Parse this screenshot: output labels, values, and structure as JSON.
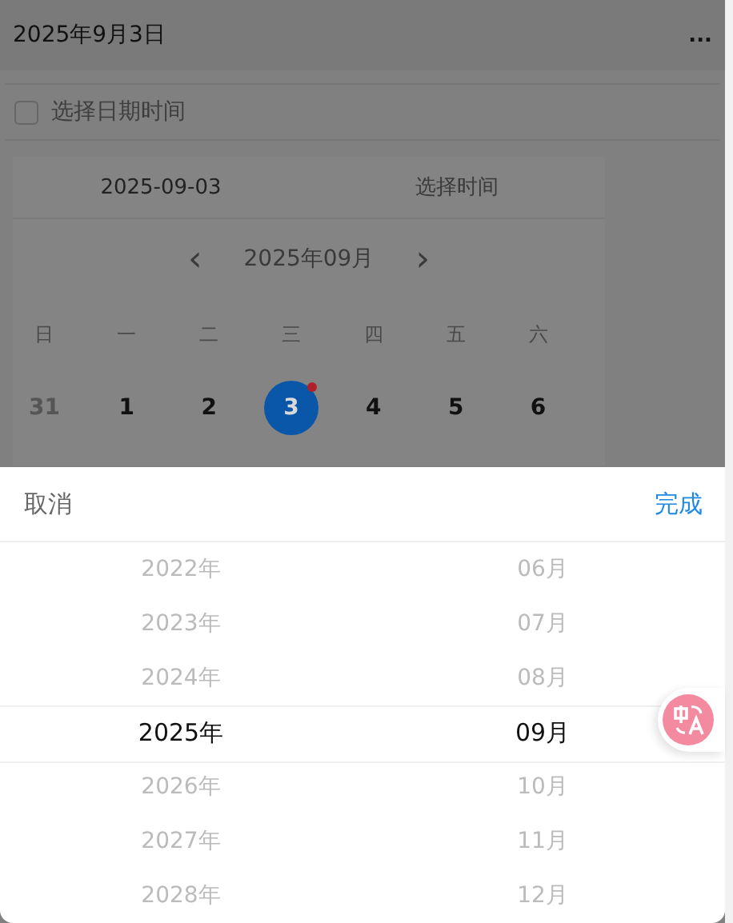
{
  "header": {
    "title": "2025年9月3日",
    "menu": "..."
  },
  "field": {
    "label": "选择日期时间",
    "checked": false
  },
  "calendar": {
    "tabs": [
      {
        "label": "2025-09-03",
        "selected": true
      },
      {
        "label": "选择时间",
        "selected": false
      }
    ],
    "prev": "‹",
    "month": "2025年09月",
    "next": "›",
    "weekdays": [
      "日",
      "一",
      "二",
      "三",
      "四",
      "五",
      "六"
    ],
    "days": [
      {
        "label": "31",
        "other_month": true,
        "selected": false,
        "marked": false
      },
      {
        "label": "1",
        "other_month": false,
        "selected": false,
        "marked": false
      },
      {
        "label": "2",
        "other_month": false,
        "selected": false,
        "marked": false
      },
      {
        "label": "3",
        "other_month": false,
        "selected": true,
        "marked": true
      },
      {
        "label": "4",
        "other_month": false,
        "selected": false,
        "marked": false
      },
      {
        "label": "5",
        "other_month": false,
        "selected": false,
        "marked": false
      },
      {
        "label": "6",
        "other_month": false,
        "selected": false,
        "marked": false
      }
    ]
  },
  "sheet": {
    "cancel": "取消",
    "done": "完成",
    "columns": [
      {
        "items": [
          {
            "label": "2022年",
            "selected": false
          },
          {
            "label": "2023年",
            "selected": false
          },
          {
            "label": "2024年",
            "selected": false
          },
          {
            "label": "2025年",
            "selected": true
          },
          {
            "label": "2026年",
            "selected": false
          },
          {
            "label": "2027年",
            "selected": false
          },
          {
            "label": "2028年",
            "selected": false
          }
        ]
      },
      {
        "items": [
          {
            "label": "06月",
            "selected": false
          },
          {
            "label": "07月",
            "selected": false
          },
          {
            "label": "08月",
            "selected": false
          },
          {
            "label": "09月",
            "selected": true
          },
          {
            "label": "10月",
            "selected": false
          },
          {
            "label": "11月",
            "selected": false
          },
          {
            "label": "12月",
            "selected": false
          }
        ]
      }
    ]
  }
}
